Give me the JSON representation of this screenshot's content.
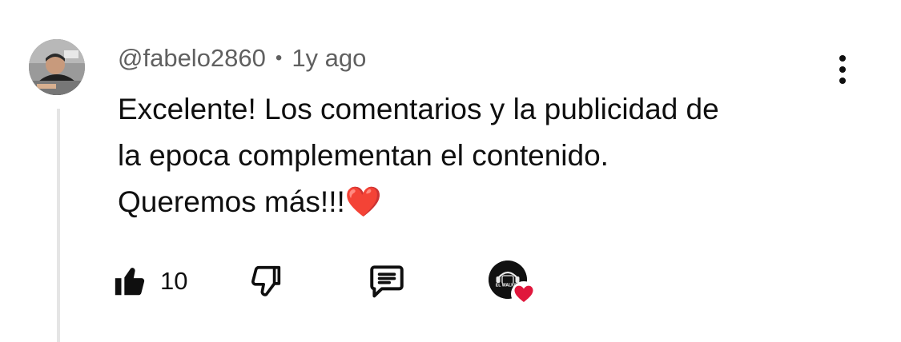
{
  "comment": {
    "author_handle": "@fabelo2860",
    "separator": "•",
    "timestamp": "1y ago",
    "text_lines": [
      "Excelente! Los comentarios y la publicidad de",
      "la epoca complementan el contenido.",
      "Queremos más!!!❤️"
    ],
    "like_count": "10",
    "creator_avatar_text": "EL WALKER"
  },
  "colors": {
    "text_primary": "#0f0f0f",
    "text_secondary": "#606060",
    "heart": "#e0173c",
    "thread_line": "#e5e5e5"
  },
  "icons": {
    "menu": "more-vertical-icon",
    "like": "thumbs-up-filled-icon",
    "dislike": "thumbs-down-outline-icon",
    "reply": "comment-icon",
    "creator_heart": "heart-icon"
  }
}
